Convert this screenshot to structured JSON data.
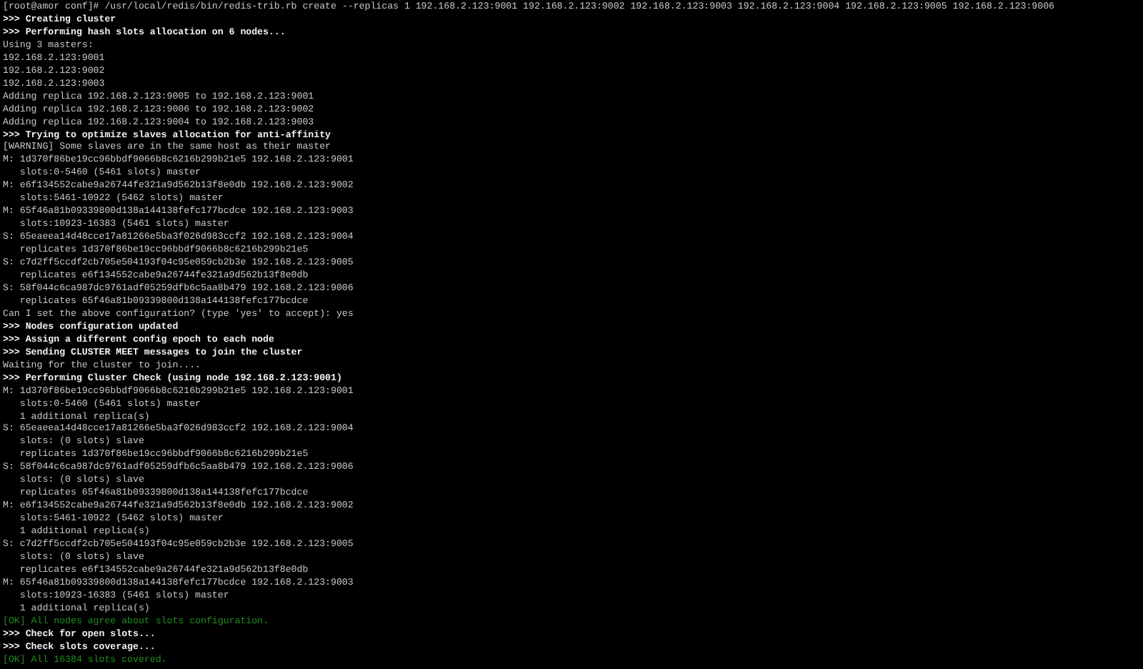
{
  "terminal": {
    "lines": [
      {
        "kind": "plain",
        "text": "[root@amor conf]# /usr/local/redis/bin/redis-trib.rb create --replicas 1 192.168.2.123:9001 192.168.2.123:9002 192.168.2.123:9003 192.168.2.123:9004 192.168.2.123:9005 192.168.2.123:9006"
      },
      {
        "kind": "bold",
        "text": ">>> Creating cluster"
      },
      {
        "kind": "bold",
        "text": ">>> Performing hash slots allocation on 6 nodes..."
      },
      {
        "kind": "plain",
        "text": "Using 3 masters:"
      },
      {
        "kind": "plain",
        "text": "192.168.2.123:9001"
      },
      {
        "kind": "plain",
        "text": "192.168.2.123:9002"
      },
      {
        "kind": "plain",
        "text": "192.168.2.123:9003"
      },
      {
        "kind": "plain",
        "text": "Adding replica 192.168.2.123:9005 to 192.168.2.123:9001"
      },
      {
        "kind": "plain",
        "text": "Adding replica 192.168.2.123:9006 to 192.168.2.123:9002"
      },
      {
        "kind": "plain",
        "text": "Adding replica 192.168.2.123:9004 to 192.168.2.123:9003"
      },
      {
        "kind": "bold",
        "text": ">>> Trying to optimize slaves allocation for anti-affinity"
      },
      {
        "kind": "plain",
        "text": "[WARNING] Some slaves are in the same host as their master"
      },
      {
        "kind": "plain",
        "text": "M: 1d370f86be19cc96bbdf9066b8c6216b299b21e5 192.168.2.123:9001"
      },
      {
        "kind": "plain",
        "text": "   slots:0-5460 (5461 slots) master"
      },
      {
        "kind": "plain",
        "text": "M: e6f134552cabe9a26744fe321a9d562b13f8e0db 192.168.2.123:9002"
      },
      {
        "kind": "plain",
        "text": "   slots:5461-10922 (5462 slots) master"
      },
      {
        "kind": "plain",
        "text": "M: 65f46a81b09339800d138a144138fefc177bcdce 192.168.2.123:9003"
      },
      {
        "kind": "plain",
        "text": "   slots:10923-16383 (5461 slots) master"
      },
      {
        "kind": "plain",
        "text": "S: 65eaeea14d48cce17a81266e5ba3f026d983ccf2 192.168.2.123:9004"
      },
      {
        "kind": "plain",
        "text": "   replicates 1d370f86be19cc96bbdf9066b8c6216b299b21e5"
      },
      {
        "kind": "plain",
        "text": "S: c7d2ff5ccdf2cb705e504193f04c95e059cb2b3e 192.168.2.123:9005"
      },
      {
        "kind": "plain",
        "text": "   replicates e6f134552cabe9a26744fe321a9d562b13f8e0db"
      },
      {
        "kind": "plain",
        "text": "S: 58f044c6ca987dc9761adf05259dfb6c5aa8b479 192.168.2.123:9006"
      },
      {
        "kind": "plain",
        "text": "   replicates 65f46a81b09339800d138a144138fefc177bcdce"
      },
      {
        "kind": "plain",
        "text": "Can I set the above configuration? (type 'yes' to accept): yes"
      },
      {
        "kind": "bold",
        "text": ">>> Nodes configuration updated"
      },
      {
        "kind": "bold",
        "text": ">>> Assign a different config epoch to each node"
      },
      {
        "kind": "bold",
        "text": ">>> Sending CLUSTER MEET messages to join the cluster"
      },
      {
        "kind": "plain",
        "text": "Waiting for the cluster to join...."
      },
      {
        "kind": "bold",
        "text": ">>> Performing Cluster Check (using node 192.168.2.123:9001)"
      },
      {
        "kind": "plain",
        "text": "M: 1d370f86be19cc96bbdf9066b8c6216b299b21e5 192.168.2.123:9001"
      },
      {
        "kind": "plain",
        "text": "   slots:0-5460 (5461 slots) master"
      },
      {
        "kind": "plain",
        "text": "   1 additional replica(s)"
      },
      {
        "kind": "plain",
        "text": "S: 65eaeea14d48cce17a81266e5ba3f026d983ccf2 192.168.2.123:9004"
      },
      {
        "kind": "plain",
        "text": "   slots: (0 slots) slave"
      },
      {
        "kind": "plain",
        "text": "   replicates 1d370f86be19cc96bbdf9066b8c6216b299b21e5"
      },
      {
        "kind": "plain",
        "text": "S: 58f044c6ca987dc9761adf05259dfb6c5aa8b479 192.168.2.123:9006"
      },
      {
        "kind": "plain",
        "text": "   slots: (0 slots) slave"
      },
      {
        "kind": "plain",
        "text": "   replicates 65f46a81b09339800d138a144138fefc177bcdce"
      },
      {
        "kind": "plain",
        "text": "M: e6f134552cabe9a26744fe321a9d562b13f8e0db 192.168.2.123:9002"
      },
      {
        "kind": "plain",
        "text": "   slots:5461-10922 (5462 slots) master"
      },
      {
        "kind": "plain",
        "text": "   1 additional replica(s)"
      },
      {
        "kind": "plain",
        "text": "S: c7d2ff5ccdf2cb705e504193f04c95e059cb2b3e 192.168.2.123:9005"
      },
      {
        "kind": "plain",
        "text": "   slots: (0 slots) slave"
      },
      {
        "kind": "plain",
        "text": "   replicates e6f134552cabe9a26744fe321a9d562b13f8e0db"
      },
      {
        "kind": "plain",
        "text": "M: 65f46a81b09339800d138a144138fefc177bcdce 192.168.2.123:9003"
      },
      {
        "kind": "plain",
        "text": "   slots:10923-16383 (5461 slots) master"
      },
      {
        "kind": "plain",
        "text": "   1 additional replica(s)"
      },
      {
        "kind": "ok",
        "text": "[OK] All nodes agree about slots configuration."
      },
      {
        "kind": "bold",
        "text": ">>> Check for open slots..."
      },
      {
        "kind": "bold",
        "text": ">>> Check slots coverage..."
      },
      {
        "kind": "ok",
        "text": "[OK] All 16384 slots covered."
      }
    ]
  }
}
